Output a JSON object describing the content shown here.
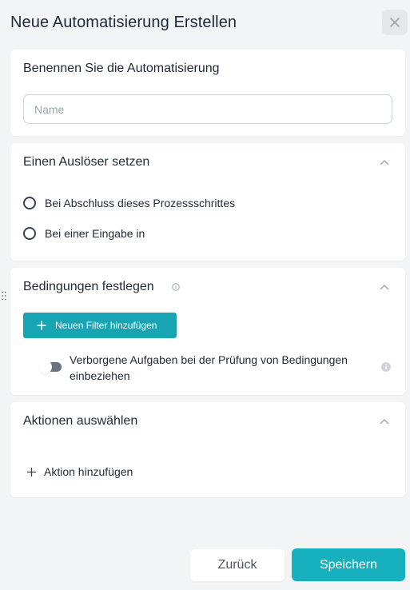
{
  "dialog": {
    "title": "Neue Automatisierung Erstellen"
  },
  "name_section": {
    "title": "Benennen Sie die Automatisierung",
    "input_value": "",
    "input_placeholder": "Name"
  },
  "trigger_section": {
    "title": "Einen Auslöser setzen",
    "options": [
      {
        "label": "Bei Abschluss dieses Prozessschrittes",
        "selected": false
      },
      {
        "label": "Bei einer Eingabe in",
        "selected": false
      }
    ]
  },
  "conditions_section": {
    "title": "Bedingungen festlegen",
    "add_filter_label": "Neuen Filter hinzufügen",
    "toggle_label": "Verborgene Aufgaben bei der Prüfung von Bedingungen einbeziehen",
    "toggle_on": false
  },
  "actions_section": {
    "title": "Aktionen auswählen",
    "add_action_label": "Aktion hinzufügen"
  },
  "footer": {
    "back_label": "Zurück",
    "save_label": "Speichern"
  },
  "colors": {
    "primary": "#17b0bf",
    "filter_button": "#17a5b4",
    "background": "#f3f4f6",
    "card": "#ffffff"
  },
  "icons": [
    "close-icon",
    "chevron-up-icon",
    "info-icon",
    "plus-icon",
    "drag-handle-icon"
  ]
}
